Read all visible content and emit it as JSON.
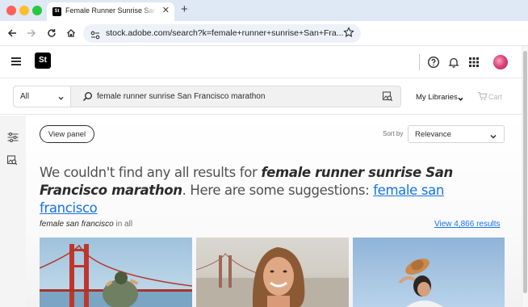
{
  "browser": {
    "tab": {
      "title": "Female Runner Sunrise San Francisco",
      "favicon_text": "St"
    },
    "url": "stock.adobe.com/search?k=female+runner+sunrise+San+Fra..."
  },
  "header": {
    "logo_text": "St",
    "icons": [
      "menu-icon",
      "help-icon",
      "bell-icon",
      "apps-grid-icon",
      "avatar"
    ]
  },
  "search": {
    "scope": "All",
    "query": "female runner sunrise San Francisco marathon"
  },
  "libraries": {
    "label": "My Libraries",
    "cart_label": "Cart"
  },
  "toolbar": {
    "view_panel_label": "View panel",
    "sort_by_label": "Sort by",
    "sort_value": "Relevance"
  },
  "message": {
    "prefix": "We couldn't find any all results for ",
    "query": "female runner sunrise San Francisco marathon",
    "middle": ". Here are some suggestions: ",
    "suggestion": "female san francisco"
  },
  "suggestion_section": {
    "term": "female san francisco",
    "scope_suffix": " in all",
    "view_results": "View 4,866 results"
  },
  "colors": {
    "link": "#1473e6",
    "text": "#2c2c2c",
    "tabbar": "#dfe8f5"
  }
}
